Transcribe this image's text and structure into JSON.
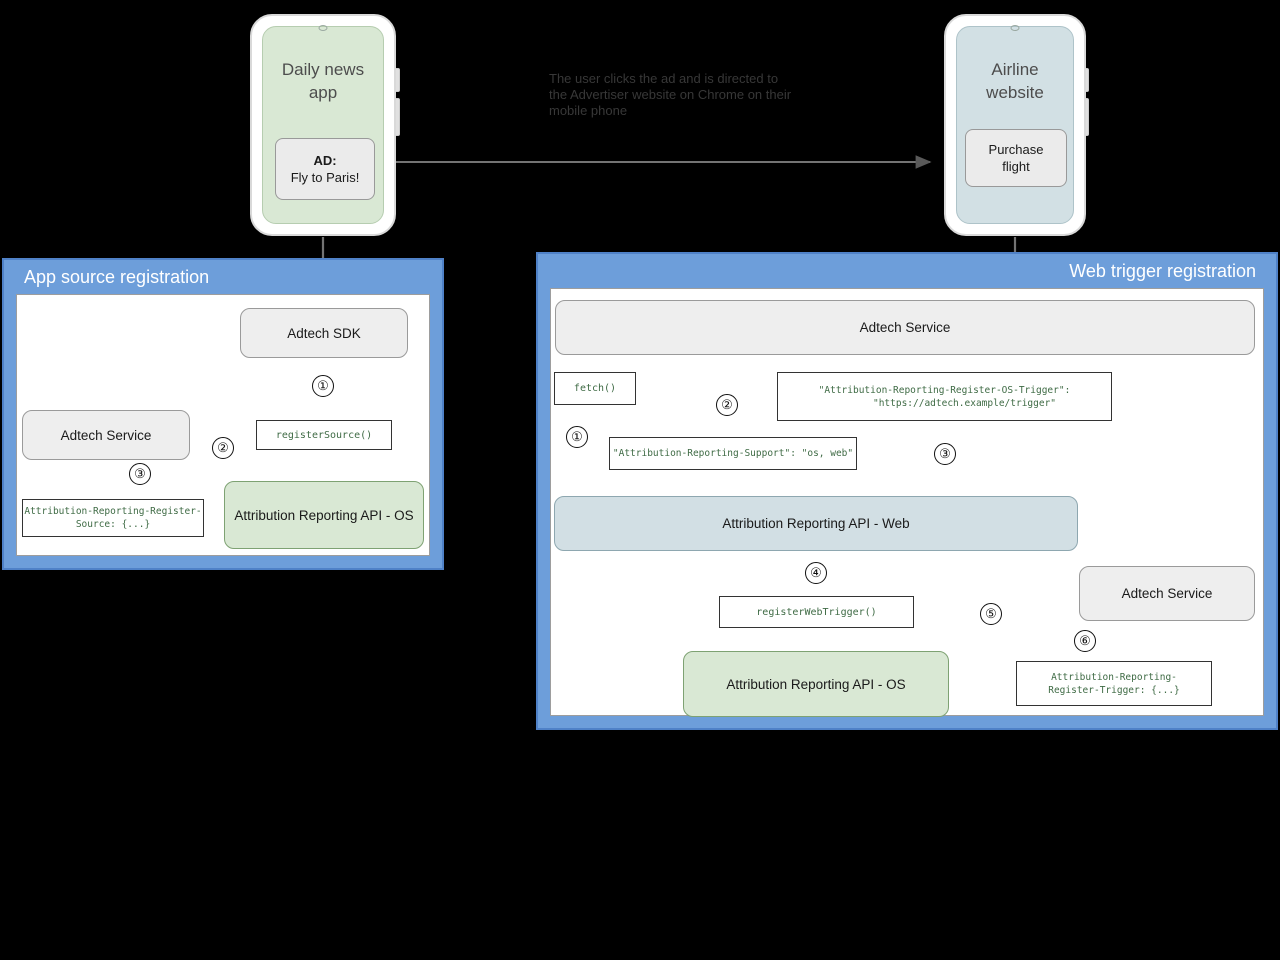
{
  "diagram": {
    "caption": "The user clicks the ad and is directed to the Advertiser website on Chrome on their mobile phone",
    "colors": {
      "panel_header": "#6d9eda",
      "panel_border": "#4f81c7",
      "node_grey": "#eeeeee",
      "node_green": "#d9e8d4",
      "node_blue": "#d2dfe4",
      "code_text": "#3f6b45",
      "arrow": "#666666"
    }
  },
  "phones": {
    "left": {
      "app_title": "Daily news\napp",
      "ad_line1": "AD:",
      "ad_line2": "Fly to Paris!"
    },
    "right": {
      "app_title": "Airline\nwebsite",
      "button_line1": "Purchase",
      "button_line2": "flight"
    }
  },
  "left_panel": {
    "title": "App source registration",
    "nodes": {
      "adtech_sdk": "Adtech SDK",
      "adtech_service": "Adtech Service",
      "ar_api_os": "Attribution Reporting API - OS"
    },
    "codeboxes": {
      "register_source": "registerSource()",
      "register_source_header": "Attribution-Reporting-Register-\nSource: {...}"
    },
    "steps": [
      "①",
      "②",
      "③"
    ]
  },
  "right_panel": {
    "title": "Web trigger registration",
    "nodes": {
      "adtech_service_top": "Adtech Service",
      "ar_api_web": "Attribution Reporting API - Web",
      "ar_api_os": "Attribution Reporting API - OS",
      "adtech_service_bottom": "Adtech Service"
    },
    "codeboxes": {
      "fetch": "fetch()",
      "support_header": "\"Attribution-Reporting-Support\": \"os, web\"",
      "os_trigger_header": "\"Attribution-Reporting-Register-OS-Trigger\":\n       \"https://adtech.example/trigger\"",
      "register_web_trigger": "registerWebTrigger()",
      "register_trigger_header": "Attribution-Reporting-\nRegister-Trigger: {...}"
    },
    "steps": [
      "①",
      "②",
      "③",
      "④",
      "⑤",
      "⑥"
    ]
  }
}
